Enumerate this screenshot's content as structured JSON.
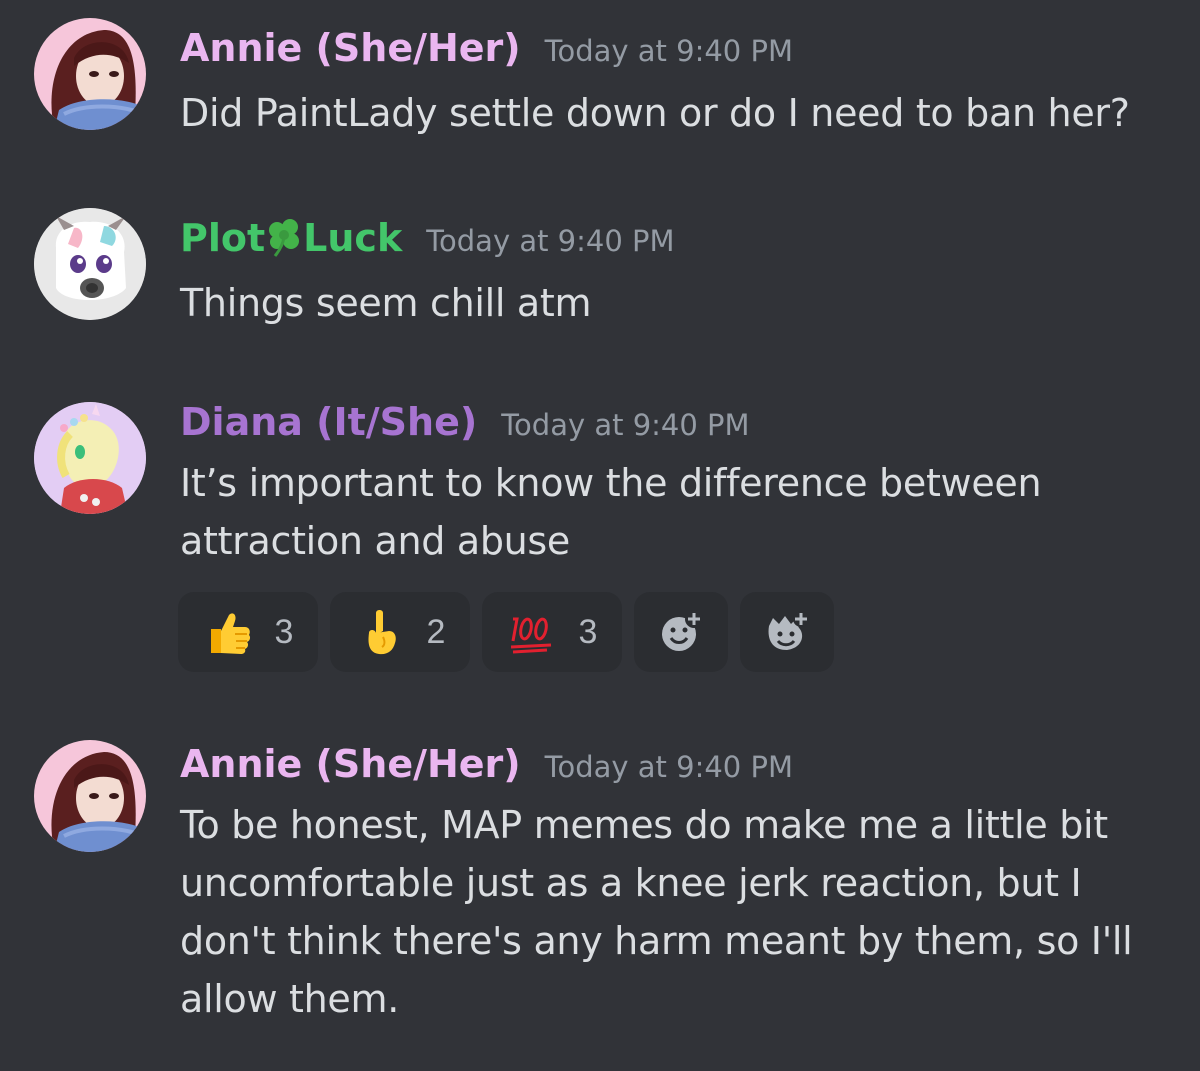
{
  "messages": [
    {
      "username": "Annie (She/Her)",
      "name_color": "#eab6f0",
      "timestamp": "Today at 9:40 PM",
      "avatar": "annie-avatar",
      "lines": [
        "Did PaintLady settle down or do I need to ban her?"
      ]
    },
    {
      "username_parts": [
        "Plot",
        "Luck"
      ],
      "name_icon": "shamrock-icon",
      "name_color": "#43c66a",
      "timestamp": "Today at 9:40 PM",
      "avatar": "plotluck-avatar",
      "lines": [
        "Things seem chill atm"
      ]
    },
    {
      "username": "Diana (It/She)",
      "name_color": "#a774d1",
      "timestamp": "Today at 9:40 PM",
      "avatar": "diana-avatar",
      "lines": [
        "It’s important to know the difference between",
        "attraction and abuse"
      ],
      "reactions": [
        {
          "emoji": "thumbs-up-icon",
          "count": "3"
        },
        {
          "emoji": "index-pointing-up-icon",
          "count": "2"
        },
        {
          "emoji": "hundred-points-icon",
          "count": "3"
        },
        {
          "emoji": "add-reaction-icon"
        },
        {
          "emoji": "add-super-reaction-icon"
        }
      ]
    },
    {
      "username": "Annie (She/Her)",
      "name_color": "#eab6f0",
      "timestamp": "Today at 9:40 PM",
      "avatar": "annie-avatar",
      "lines": [
        "To be honest, MAP memes do make me a little bit",
        "uncomfortable just as a knee jerk reaction, but I",
        "don't think there's any harm meant by them, so I'll",
        "allow them."
      ]
    }
  ],
  "colors": {
    "background": "#313338",
    "text": "#dbdee1",
    "timestamp": "#949ba4",
    "reaction_bg": "#2b2d31"
  }
}
